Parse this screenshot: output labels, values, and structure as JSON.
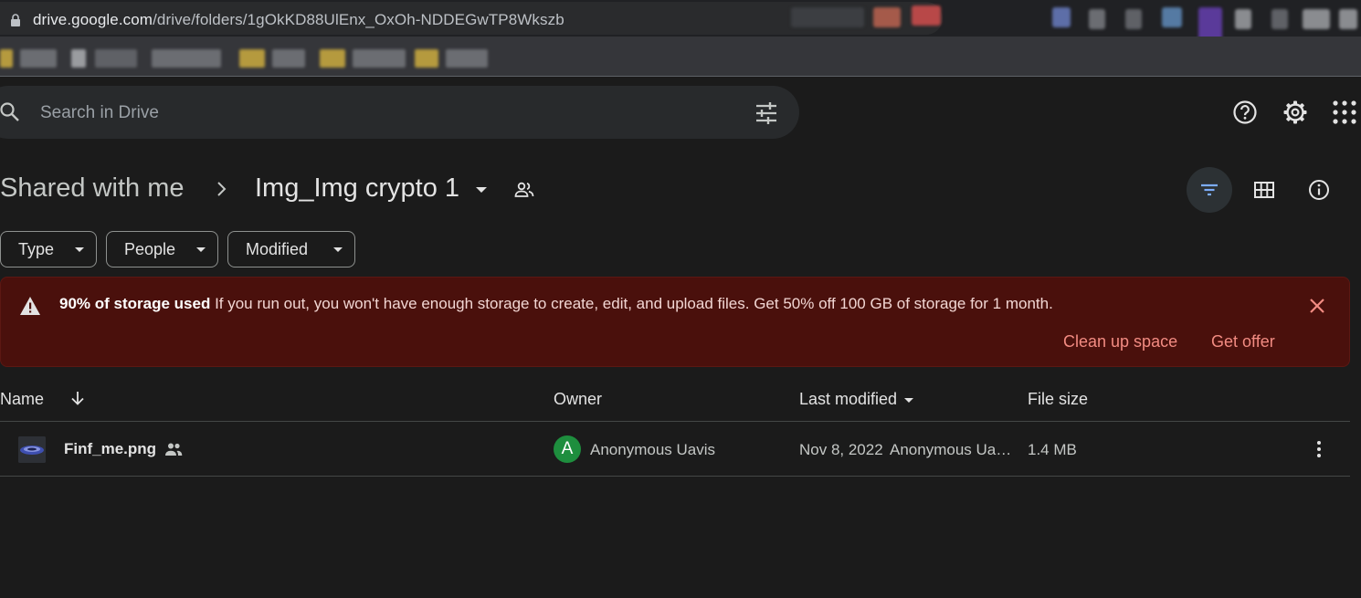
{
  "browser": {
    "url_host": "drive.google.com",
    "url_path": "/drive/folders/1gOkKD88UlEnx_OxOh-NDDEGwTP8Wkszb"
  },
  "header": {
    "search_placeholder": "Search in Drive",
    "icons": [
      "search-icon",
      "tune-icon",
      "help-icon",
      "settings-icon",
      "apps-icon"
    ]
  },
  "breadcrumb": {
    "root": "Shared with me",
    "current": "Img_Img crypto 1"
  },
  "filters": {
    "type": "Type",
    "people": "People",
    "modified": "Modified"
  },
  "banner": {
    "title": "90% of storage used",
    "message": "If you run out, you won't have enough storage to create, edit, and upload files. Get 50% off 100 GB of storage for 1 month.",
    "clean_up": "Clean up space",
    "get_offer": "Get offer",
    "bg_color": "#4a100c",
    "action_color": "#f28b82"
  },
  "table": {
    "headers": {
      "name": "Name",
      "owner": "Owner",
      "last_modified": "Last modified",
      "file_size": "File size"
    },
    "rows": [
      {
        "name": "Finf_me.png",
        "owner_initial": "A",
        "owner": "Anonymous Uavis",
        "modified_date": "Nov 8, 2022",
        "modified_by": "Anonymous Uavis",
        "size": "1.4 MB"
      }
    ]
  }
}
